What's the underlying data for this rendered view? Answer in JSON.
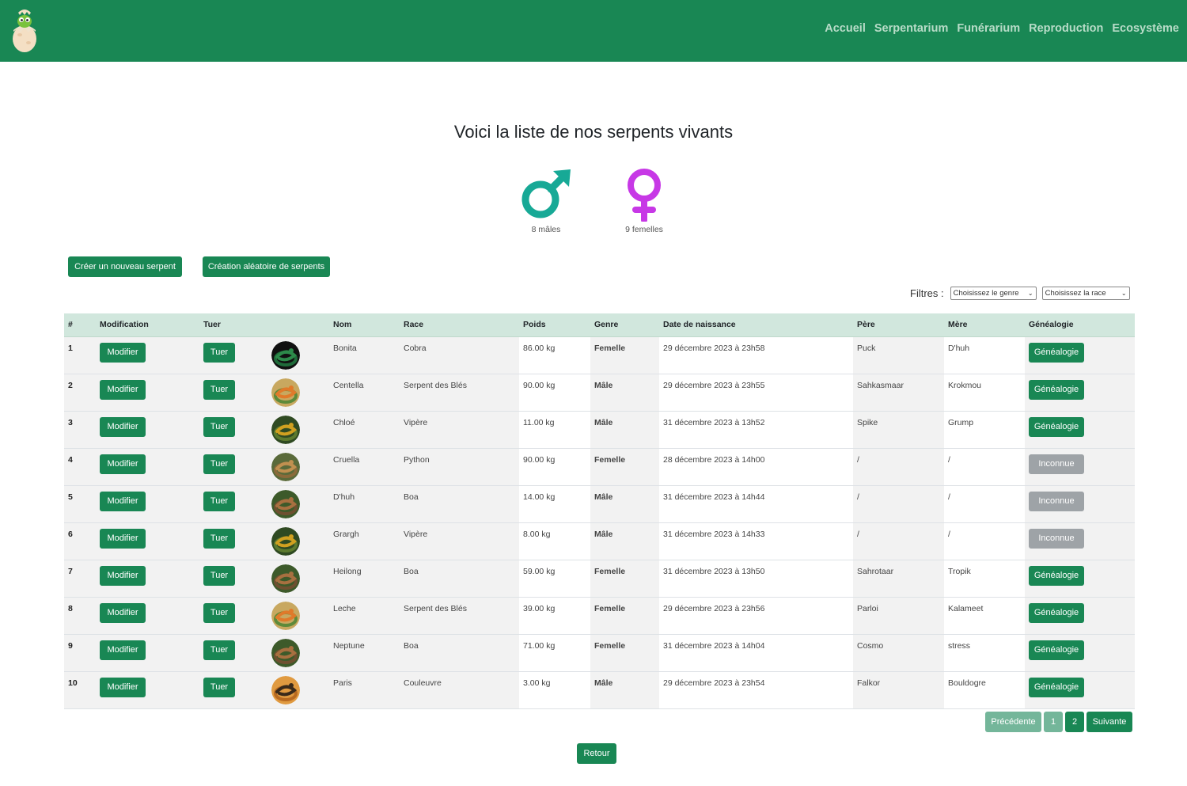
{
  "nav": {
    "links": [
      "Accueil",
      "Serpentarium",
      "Funérarium",
      "Reproduction",
      "Ecosystème"
    ]
  },
  "title": "Voici la liste de nos serpents vivants",
  "stats": {
    "males": "8 mâles",
    "females": "9 femelles"
  },
  "colors": {
    "brand": "#198754",
    "header_row": "#d1e7dd",
    "female": "#e83ec8",
    "male": "#4b8fe8",
    "unknown_btn": "#9ea3a7"
  },
  "actions": {
    "create": "Créer un nouveau serpent",
    "random": "Création aléatoire de serpents"
  },
  "filters": {
    "label": "Filtres :",
    "genre": "Choisissez le genre",
    "race": "Choisissez la race"
  },
  "table": {
    "headers": [
      "#",
      "Modification",
      "Tuer",
      "",
      "Nom",
      "Race",
      "Poids",
      "Genre",
      "Date de naissance",
      "Père",
      "Mère",
      "Généalogie"
    ],
    "rows": [
      {
        "n": "1",
        "edit": "Modifier",
        "kill": "Tuer",
        "avatar": "cobra-avatar",
        "name": "Bonita",
        "race": "Cobra",
        "weight": "86.00 kg",
        "gender": "Femelle",
        "born": "29 décembre 2023 à 23h58",
        "father": "Puck",
        "mother": "D'huh",
        "genealogy": "Généalogie",
        "known": true
      },
      {
        "n": "2",
        "edit": "Modifier",
        "kill": "Tuer",
        "avatar": "corn-snake-avatar",
        "name": "Centella",
        "race": "Serpent des Blés",
        "weight": "90.00 kg",
        "gender": "Mâle",
        "born": "29 décembre 2023 à 23h55",
        "father": "Sahkasmaar",
        "mother": "Krokmou",
        "genealogy": "Généalogie",
        "known": true
      },
      {
        "n": "3",
        "edit": "Modifier",
        "kill": "Tuer",
        "avatar": "viper-avatar",
        "name": "Chloé",
        "race": "Vipère",
        "weight": "11.00 kg",
        "gender": "Mâle",
        "born": "31 décembre 2023 à 13h52",
        "father": "Spike",
        "mother": "Grump",
        "genealogy": "Généalogie",
        "known": true
      },
      {
        "n": "4",
        "edit": "Modifier",
        "kill": "Tuer",
        "avatar": "python-avatar",
        "name": "Cruella",
        "race": "Python",
        "weight": "90.00 kg",
        "gender": "Femelle",
        "born": "28 décembre 2023 à 14h00",
        "father": "/",
        "mother": "/",
        "genealogy": "Inconnue",
        "known": false
      },
      {
        "n": "5",
        "edit": "Modifier",
        "kill": "Tuer",
        "avatar": "boa-avatar",
        "name": "D'huh",
        "race": "Boa",
        "weight": "14.00 kg",
        "gender": "Mâle",
        "born": "31 décembre 2023 à 14h44",
        "father": "/",
        "mother": "/",
        "genealogy": "Inconnue",
        "known": false
      },
      {
        "n": "6",
        "edit": "Modifier",
        "kill": "Tuer",
        "avatar": "viper-avatar",
        "name": "Grargh",
        "race": "Vipère",
        "weight": "8.00 kg",
        "gender": "Mâle",
        "born": "31 décembre 2023 à 14h33",
        "father": "/",
        "mother": "/",
        "genealogy": "Inconnue",
        "known": false
      },
      {
        "n": "7",
        "edit": "Modifier",
        "kill": "Tuer",
        "avatar": "boa-avatar",
        "name": "Heilong",
        "race": "Boa",
        "weight": "59.00 kg",
        "gender": "Femelle",
        "born": "31 décembre 2023 à 13h50",
        "father": "Sahrotaar",
        "mother": "Tropik",
        "genealogy": "Généalogie",
        "known": true
      },
      {
        "n": "8",
        "edit": "Modifier",
        "kill": "Tuer",
        "avatar": "corn-snake-avatar",
        "name": "Leche",
        "race": "Serpent des Blés",
        "weight": "39.00 kg",
        "gender": "Femelle",
        "born": "29 décembre 2023 à 23h56",
        "father": "Parloi",
        "mother": "Kalameet",
        "genealogy": "Généalogie",
        "known": true
      },
      {
        "n": "9",
        "edit": "Modifier",
        "kill": "Tuer",
        "avatar": "boa-avatar",
        "name": "Neptune",
        "race": "Boa",
        "weight": "71.00 kg",
        "gender": "Femelle",
        "born": "31 décembre 2023 à 14h04",
        "father": "Cosmo",
        "mother": "stress",
        "genealogy": "Généalogie",
        "known": true
      },
      {
        "n": "10",
        "edit": "Modifier",
        "kill": "Tuer",
        "avatar": "grass-snake-avatar",
        "name": "Paris",
        "race": "Couleuvre",
        "weight": "3.00 kg",
        "gender": "Mâle",
        "born": "29 décembre 2023 à 23h54",
        "father": "Falkor",
        "mother": "Bouldogre",
        "genealogy": "Généalogie",
        "known": true
      }
    ]
  },
  "pagination": {
    "prev": "Précédente",
    "pages": [
      "1",
      "2"
    ],
    "next": "Suivante"
  },
  "back": "Retour"
}
